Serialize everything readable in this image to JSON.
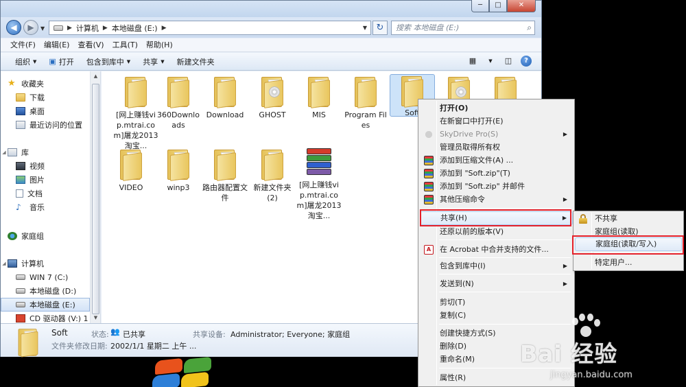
{
  "window": {
    "controls": {
      "minimize": "─",
      "maximize": "□",
      "close": "✕"
    }
  },
  "address": {
    "path": [
      "计算机",
      "本地磁盘 (E:)"
    ],
    "search_placeholder": "搜索 本地磁盘 (E:)"
  },
  "menubar": [
    "文件(F)",
    "编辑(E)",
    "查看(V)",
    "工具(T)",
    "帮助(H)"
  ],
  "toolbar": {
    "organize": "组织",
    "open": "打开",
    "include_library": "包含到库中",
    "share": "共享",
    "new_folder": "新建文件夹"
  },
  "nav": {
    "favorites": "收藏夹",
    "downloads": "下载",
    "desktop": "桌面",
    "recent": "最近访问的位置",
    "libraries": "库",
    "videos": "视频",
    "pictures": "图片",
    "documents": "文档",
    "music": "音乐",
    "homegroup": "家庭组",
    "computer": "计算机",
    "drive_c": "WIN 7 (C:)",
    "drive_d": "本地磁盘 (D:)",
    "drive_e": "本地磁盘 (E:)",
    "drive_cd": "CD 驱动器 (V:) 1"
  },
  "files": [
    {
      "name": "[网上赚钱vip.mtrai.com]屠龙2013淘宝..."
    },
    {
      "name": "360Downloads"
    },
    {
      "name": "Download"
    },
    {
      "name": "GHOST"
    },
    {
      "name": "MIS"
    },
    {
      "name": "Program Files"
    },
    {
      "name": "Soft"
    },
    {
      "name": "VIDEO"
    },
    {
      "name": "winp3"
    },
    {
      "name": "路由器配置文件"
    },
    {
      "name": "新建文件夹 (2)"
    },
    {
      "name": "[网上赚钱vip.mtrai.com]屠龙2013淘宝..."
    }
  ],
  "details": {
    "name": "Soft",
    "type": "文件夹",
    "status_label": "状态:",
    "status_value": "已共享",
    "shared_label": "共享设备:",
    "shared_value": "Administrator; Everyone; 家庭组",
    "modified_label": "修改日期:",
    "modified_value": "2002/1/1 星期二 上午 ..."
  },
  "context_menu": {
    "open": "打开(O)",
    "open_new_window": "在新窗口中打开(E)",
    "skydrive": "SkyDrive Pro(S)",
    "take_ownership": "管理员取得所有权",
    "add_archive": "添加到压缩文件(A) ...",
    "add_soft_zip": "添加到 \"Soft.zip\"(T)",
    "add_soft_zip_email": "添加到 \"Soft.zip\" 并邮件",
    "other_compress": "其他压缩命令",
    "share": "共享(H)",
    "restore_versions": "还原以前的版本(V)",
    "acrobat": "在 Acrobat 中合并支持的文件...",
    "include_library": "包含到库中(I)",
    "send_to": "发送到(N)",
    "cut": "剪切(T)",
    "copy": "复制(C)",
    "create_shortcut": "创建快捷方式(S)",
    "delete": "删除(D)",
    "rename": "重命名(M)",
    "properties": "属性(R)"
  },
  "share_submenu": {
    "no_share": "不共享",
    "homegroup_read": "家庭组(读取)",
    "homegroup_readwrite": "家庭组(读取/写入)",
    "specific_users": "特定用户..."
  },
  "watermark": {
    "text": "Bai 经验",
    "url": "jingyan.baidu.com"
  }
}
